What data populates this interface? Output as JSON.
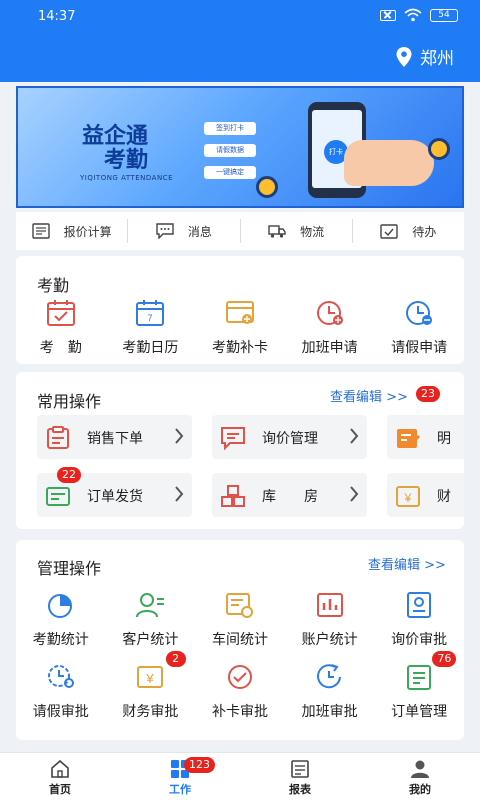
{
  "status_bar": {
    "time": "14:37",
    "battery": "54"
  },
  "header": {
    "location": "郑州"
  },
  "banner": {
    "title_line1": "益企通",
    "title_line2": "考勤",
    "subtitle": "YIQITONG ATTENDANCE",
    "pills": [
      "签到打卡",
      "请假数据",
      "一键搞定"
    ],
    "phone_button": "打卡"
  },
  "quick_bar": [
    {
      "label": "报价计算",
      "icon": "quote-icon"
    },
    {
      "label": "消息",
      "icon": "message-icon"
    },
    {
      "label": "物流",
      "icon": "truck-icon"
    },
    {
      "label": "待办",
      "icon": "todo-icon"
    }
  ],
  "attendance": {
    "title": "考勤",
    "items": [
      {
        "label": "考　勤",
        "icon": "clock-in-icon",
        "color": "#e0534a"
      },
      {
        "label": "考勤日历",
        "icon": "calendar-icon",
        "color": "#2f7de0"
      },
      {
        "label": "考勤补卡",
        "icon": "card-replace-icon",
        "color": "#e2a33a"
      },
      {
        "label": "加班申请",
        "icon": "overtime-icon",
        "color": "#e0534a"
      },
      {
        "label": "请假申请",
        "icon": "leave-icon",
        "color": "#2f7de0"
      }
    ]
  },
  "common_ops": {
    "title": "常用操作",
    "link": "查看编辑 >>",
    "badge": "23",
    "items": [
      {
        "label": "销售下单",
        "icon": "sales-order-icon",
        "color": "#e0534a",
        "badge": ""
      },
      {
        "label": "询价管理",
        "icon": "inquiry-icon",
        "color": "#e0534a",
        "badge": ""
      },
      {
        "label": "明",
        "icon": "edit-doc-icon",
        "color": "#f08a2e",
        "badge": ""
      },
      {
        "label": "订单发货",
        "icon": "ship-order-icon",
        "color": "#39a85a",
        "badge": "22"
      },
      {
        "label": "库　　房",
        "icon": "warehouse-icon",
        "color": "#e0534a",
        "badge": ""
      },
      {
        "label": "财",
        "icon": "finance-icon",
        "color": "#e2a33a",
        "badge": ""
      }
    ]
  },
  "management_ops": {
    "title": "管理操作",
    "link": "查看编辑 >>",
    "row1": [
      {
        "label": "考勤统计",
        "icon": "pie-chart-icon",
        "color": "#2f7de0",
        "badge": ""
      },
      {
        "label": "客户统计",
        "icon": "customer-icon",
        "color": "#39a85a",
        "badge": ""
      },
      {
        "label": "车间统计",
        "icon": "workshop-icon",
        "color": "#e2a33a",
        "badge": ""
      },
      {
        "label": "账户统计",
        "icon": "bar-chart-icon",
        "color": "#e0534a",
        "badge": ""
      },
      {
        "label": "询价审批",
        "icon": "inquiry-approve-icon",
        "color": "#2f7de0",
        "badge": ""
      }
    ],
    "row2": [
      {
        "label": "请假审批",
        "icon": "leave-approve-icon",
        "color": "#2f7de0",
        "badge": ""
      },
      {
        "label": "财务审批",
        "icon": "finance-approve-icon",
        "color": "#e2a33a",
        "badge": "2"
      },
      {
        "label": "补卡审批",
        "icon": "check-approve-icon",
        "color": "#e0534a",
        "badge": ""
      },
      {
        "label": "加班审批",
        "icon": "overtime-approve-icon",
        "color": "#2f7de0",
        "badge": ""
      },
      {
        "label": "订单管理",
        "icon": "order-manage-icon",
        "color": "#39a85a",
        "badge": "76"
      }
    ]
  },
  "tab_bar": [
    {
      "label": "首页",
      "icon": "home-icon",
      "badge": ""
    },
    {
      "label": "工作",
      "icon": "work-grid-icon",
      "badge": "123"
    },
    {
      "label": "报表",
      "icon": "report-icon",
      "badge": ""
    },
    {
      "label": "我的",
      "icon": "profile-icon",
      "badge": ""
    }
  ]
}
